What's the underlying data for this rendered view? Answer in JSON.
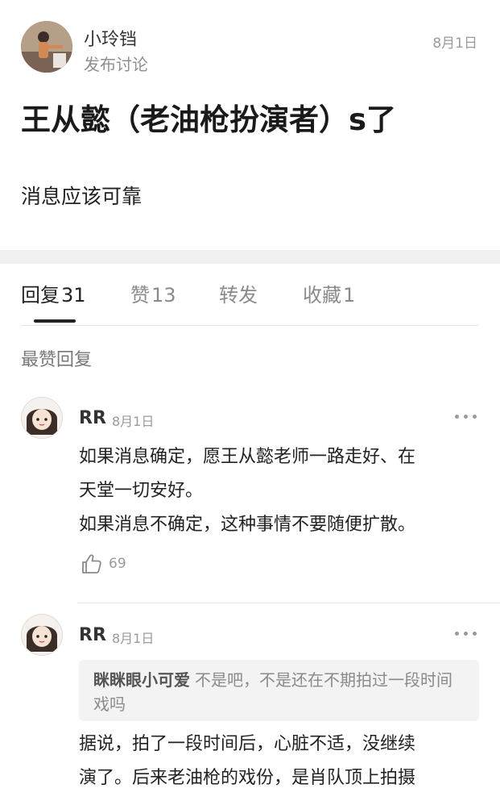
{
  "post": {
    "author": "小玲铛",
    "action": "发布讨论",
    "date": "8月1日",
    "title": "王从懿（老油枪扮演者）s了",
    "body": "消息应该可靠"
  },
  "tabs": [
    {
      "label": "回复",
      "count": "31"
    },
    {
      "label": "赞",
      "count": "13"
    },
    {
      "label": "转发",
      "count": ""
    },
    {
      "label": "收藏",
      "count": "1"
    }
  ],
  "section_label": "最赞回复",
  "replies": [
    {
      "name": "RR",
      "date": "8月1日",
      "lines": [
        "如果消息确定，愿王从懿老师一路走好、在",
        "天堂一切安好。",
        "如果消息不确定，这种事情不要随便扩散。"
      ],
      "likes": "69"
    },
    {
      "name": "RR",
      "date": "8月1日",
      "quote": {
        "user": "眯眯眼小可爱",
        "text": "不是吧，不是还在不期拍过一段时间戏吗"
      },
      "lines": [
        "据说，拍了一段时间后，心脏不适，没继续",
        "演了。后来老油枪的戏份，是肖队顶上拍摄"
      ]
    }
  ],
  "colors": {
    "text": "#222222",
    "muted": "#9a9a9a",
    "band": "#f0f0f0"
  }
}
